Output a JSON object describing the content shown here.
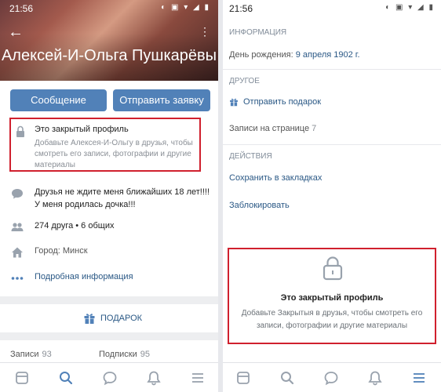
{
  "left": {
    "status": {
      "time": "21:56"
    },
    "header": {
      "name": "Алексей-И-Ольга Пушкарёвы"
    },
    "actions": {
      "message_label": "Сообщение",
      "request_label": "Отправить заявку"
    },
    "closed": {
      "title": "Это закрытый профиль",
      "description": "Добавьте Алексея-И-Ольгу в друзья, чтобы смотреть его записи, фотографии и другие материалы"
    },
    "info": {
      "status_text": "Друзья не ждите меня ближайших 18 лет!!!! У меня родилась дочка!!!",
      "friends": "274 друга • 6 общих",
      "city": "Город: Минск",
      "more": "Подробная информация"
    },
    "gift_label": "ПОДАРОК",
    "stats": {
      "posts_label": "Записи",
      "posts_value": "93",
      "subs_label": "Подписки",
      "subs_value": "95"
    },
    "tabs": [
      {
        "name": "news-icon",
        "active": false
      },
      {
        "name": "search-icon",
        "active": true
      },
      {
        "name": "messages-icon",
        "active": false
      },
      {
        "name": "notifications-icon",
        "active": false
      },
      {
        "name": "menu-icon",
        "active": false
      }
    ]
  },
  "right": {
    "status": {
      "time": "21:56"
    },
    "info_header": "ИНФОРМАЦИЯ",
    "birthday_label": "День рождения:",
    "birthday_value": "9 апреля 1902 г.",
    "other_header": "ДРУГОЕ",
    "send_gift": "Отправить подарок",
    "posts_on_page_label": "Записи на странице",
    "posts_on_page_value": "7",
    "actions_header": "ДЕЙСТВИЯ",
    "bookmark": "Сохранить в закладках",
    "block": "Заблокировать",
    "closed": {
      "title": "Это закрытый профиль",
      "description": "Добавьте Закрытыя в друзья, чтобы смотреть его записи, фотографии и другие материалы"
    }
  },
  "colors": {
    "accent": "#5181b8",
    "link": "#2a5885",
    "highlight": "#d0202e",
    "muted": "#818c99"
  }
}
